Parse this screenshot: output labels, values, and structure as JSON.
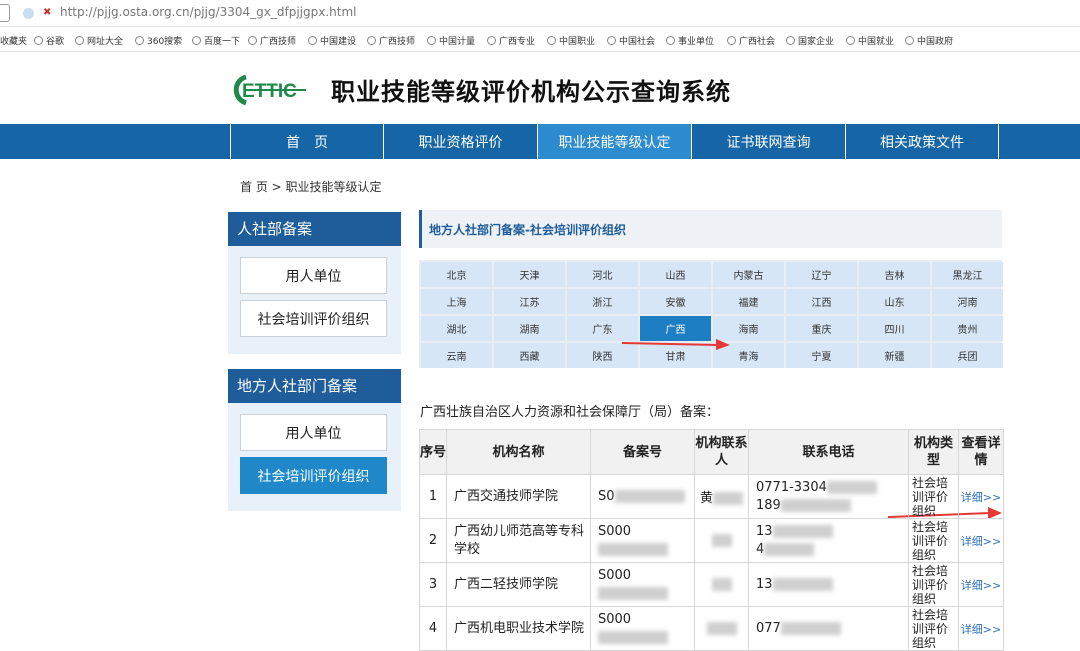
{
  "browser": {
    "url": "http://pjjg.osta.org.cn/pjjg/3304_gx_dfpjjgpx.html",
    "favorites": [
      "收藏夹",
      "谷歌",
      "网址大全",
      "360搜索",
      "百度一下",
      "广西技师",
      "中国建设",
      "广西技师",
      "中国计量",
      "广西专业",
      "中国职业",
      "中国社会",
      "事业单位",
      "广西社会",
      "国家企业",
      "中国就业",
      "中国政府"
    ]
  },
  "header": {
    "logo_text": "ETTIC",
    "title": "职业技能等级评价机构公示查询系统"
  },
  "nav": [
    "首　页",
    "职业资格评价",
    "职业技能等级认定",
    "证书联网查询",
    "相关政策文件"
  ],
  "breadcrumb": {
    "home": "首 页",
    "sep": ">",
    "current": "职业技能等级认定"
  },
  "sidebar": {
    "panel1": {
      "title": "人社部备案",
      "items": [
        "用人单位",
        "社会培训评价组织"
      ]
    },
    "panel2": {
      "title": "地方人社部门备案",
      "items": [
        "用人单位",
        "社会培训评价组织"
      ]
    }
  },
  "section_title": "地方人社部门备案-社会培训评价组织",
  "provinces": [
    "北京",
    "天津",
    "河北",
    "山西",
    "内蒙古",
    "辽宁",
    "吉林",
    "黑龙江",
    "上海",
    "江苏",
    "浙江",
    "安徽",
    "福建",
    "江西",
    "山东",
    "河南",
    "湖北",
    "湖南",
    "广东",
    "广西",
    "海南",
    "重庆",
    "四川",
    "贵州",
    "云南",
    "西藏",
    "陕西",
    "甘肃",
    "青海",
    "宁夏",
    "新疆",
    "兵团"
  ],
  "selected_province": "广西",
  "table_title": "广西壮族自治区人力资源和社会保障厅（局）备案：",
  "table": {
    "headers": [
      "序号",
      "机构名称",
      "备案号",
      "机构联系人",
      "联系电话",
      "机构类型",
      "查看详情"
    ],
    "rows": [
      {
        "no": "1",
        "name": "广西交通技师学院",
        "code": "S0",
        "contact": "黄",
        "phone1": "0771-3304",
        "phone2": "189",
        "type": "社会培训评价组织",
        "detail": "详细>>"
      },
      {
        "no": "2",
        "name": "广西幼儿师范高等专科学校",
        "code": "S000",
        "contact": "",
        "phone1": "13",
        "phone2": "4",
        "type": "社会培训评价组织",
        "detail": "详细>>"
      },
      {
        "no": "3",
        "name": "广西二轻技师学院",
        "code": "S000",
        "contact": "",
        "phone1": "13",
        "phone2": "",
        "type": "社会培训评价组织",
        "detail": "详细>>"
      },
      {
        "no": "4",
        "name": "广西机电职业技术学院",
        "code": "S000",
        "contact": "",
        "phone1": "077",
        "phone2": "",
        "type": "社会培训评价组织",
        "detail": "详细>>"
      }
    ]
  },
  "colors": {
    "nav": "#1565a7",
    "nav_active": "#2d8ccf",
    "panel_head": "#1f5d9a",
    "selected": "#1e7ec4",
    "arrow": "#e53935",
    "link": "#2b6fb6"
  }
}
